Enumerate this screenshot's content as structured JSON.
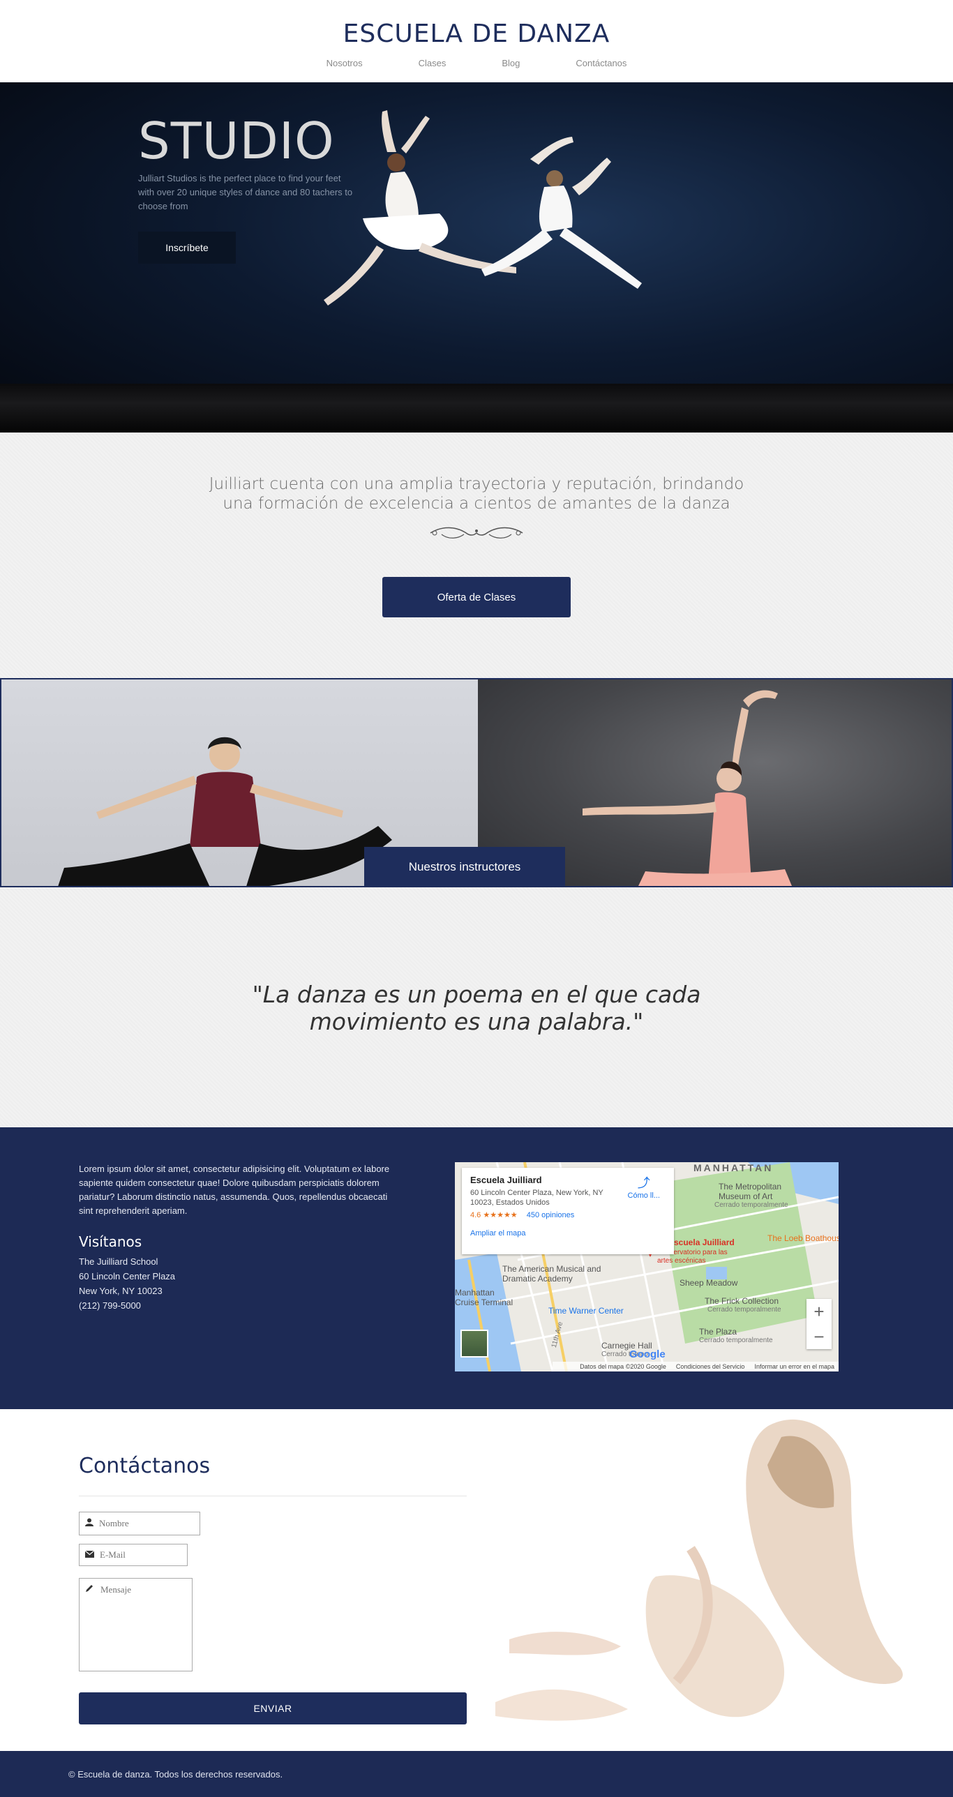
{
  "header": {
    "title": "ESCUELA DE DANZA",
    "nav": [
      "Nosotros",
      "Clases",
      "Blog",
      "Contáctanos"
    ]
  },
  "hero": {
    "title": "STUDIO",
    "subtitle": "Julliart Studios is the perfect place to find your feet with over 20 unique styles of dance and 80 tachers to choose from",
    "button": "Inscríbete"
  },
  "intro": {
    "text": "Juilliart cuenta con una amplia trayectoria y reputación, brindando una formación de excelencia a cientos de amantes de la danza",
    "button": "Oferta de Clases"
  },
  "instructors": {
    "button": "Nuestros instructores"
  },
  "quote": {
    "text": "\"La danza es un poema en el que cada movimiento es una palabra.\""
  },
  "info": {
    "lorem": "Lorem ipsum dolor sit amet, consectetur adipisicing elit. Voluptatum ex labore sapiente quidem consectetur quae! Dolore quibusdam perspiciatis dolorem pariatur? Laborum distinctio natus, assumenda. Quos, repellendus obcaecati sint reprehenderit aperiam.",
    "visit_title": "Visítanos",
    "visit_lines": [
      "The Juilliard School",
      "60 Lincoln Center Plaza",
      "New York, NY 10023",
      "(212) 799-5000"
    ]
  },
  "map": {
    "place_name": "Escuela Juilliard",
    "address": "60 Lincoln Center Plaza, New York, NY 10023, Estados Unidos",
    "rating": "4.6",
    "stars": "★★★★★",
    "reviews": "450 opiniones",
    "directions": "Cómo ll...",
    "enlarge": "Ampliar el mapa",
    "zoom_in": "+",
    "zoom_out": "−",
    "logo": "Google",
    "footer": [
      "Datos del mapa ©2020 Google",
      "Condiciones del Servicio",
      "Informar un error en el mapa"
    ],
    "labels": {
      "manhattan": "MANHATTAN",
      "met": "The Metropolitan Museum of Art",
      "closed1": "Cerrado temporalmente",
      "loeb": "The Loeb Boathouse",
      "juilliard": "Escuela Juilliard",
      "conservatorio": "Conservatorio para las artes escénicas",
      "amda": "The American Musical and Dramatic Academy",
      "sheep": "Sheep Meadow",
      "cruise": "Manhattan Cruise Terminal",
      "frick": "The Frick Collection",
      "closed2": "Cerrado temporalmente",
      "twc": "Time Warner Center",
      "carnegie": "Carnegie Hall",
      "closed3": "Cerrado tempo",
      "plaza": "The Plaza",
      "closed4": "Cerrado temporalmente",
      "street": "11th Ave"
    }
  },
  "contact": {
    "title": "Contáctanos",
    "name_placeholder": "Nombre",
    "email_placeholder": "E-Mail",
    "message_placeholder": "Mensaje",
    "button": "ENVIAR"
  },
  "footer": {
    "text": "© Escuela de danza. Todos los derechos reservados."
  },
  "colors": {
    "navy": "#1e2d5c",
    "footer_bg": "#1d2a55",
    "hero_dark": "#0a1424"
  }
}
